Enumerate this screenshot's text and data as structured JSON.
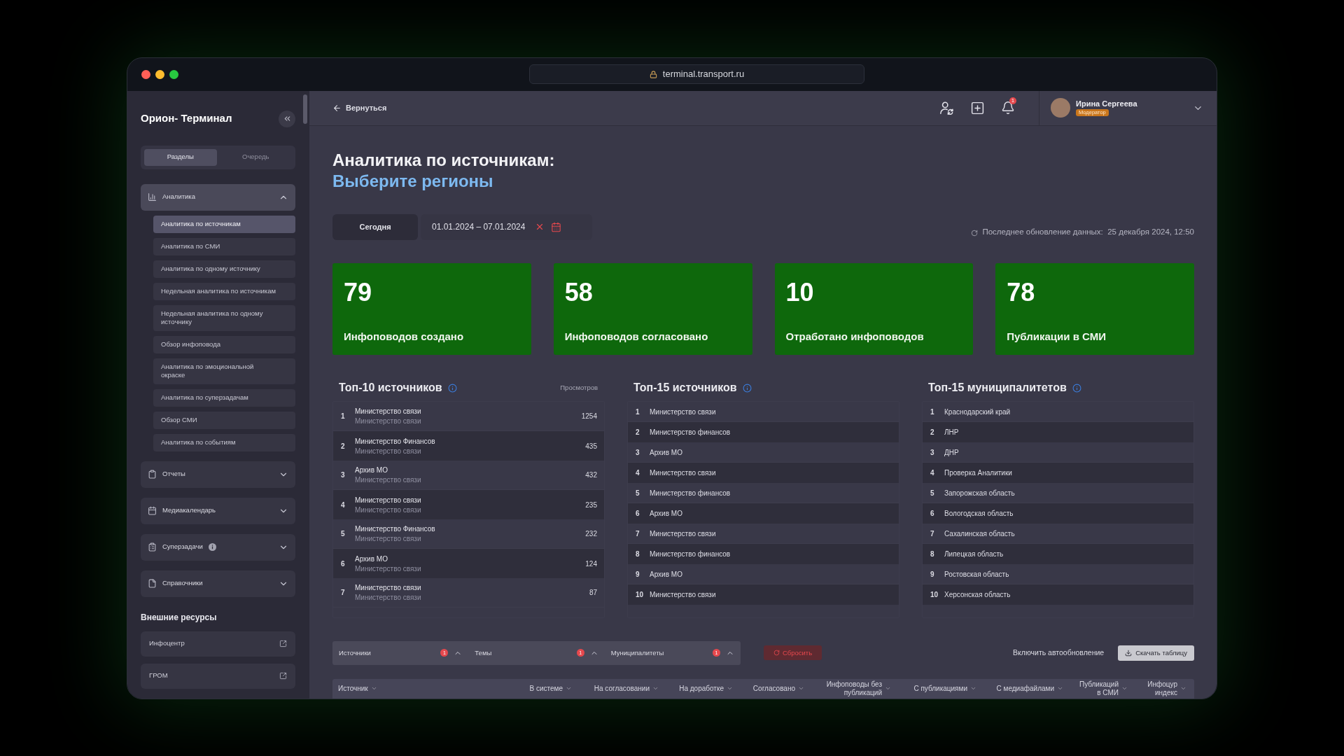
{
  "browser": {
    "url": "terminal.transport.ru"
  },
  "sidebar": {
    "title": "Орион- Терминал",
    "tabs": [
      {
        "label": "Разделы",
        "selected": true
      },
      {
        "label": "Очередь",
        "selected": false
      }
    ],
    "sections": [
      {
        "label": "Аналитика",
        "expanded": true,
        "info_badge": false,
        "children": [
          {
            "label": "Аналитика по источникам",
            "selected": true
          },
          {
            "label": "Аналитика по СМИ",
            "selected": false
          },
          {
            "label": "Аналитика по одному источнику",
            "selected": false
          },
          {
            "label": "Недельная аналитика по источникам",
            "selected": false
          },
          {
            "label": "Недельная аналитика по одному источнику",
            "selected": false
          },
          {
            "label": "Обзор инфоповода",
            "selected": false
          },
          {
            "label": "Аналитика по эмоциональной окраске",
            "selected": false
          },
          {
            "label": "Аналитика по суперзадачам",
            "selected": false
          },
          {
            "label": "Обзор СМИ",
            "selected": false
          },
          {
            "label": "Аналитика по событиям",
            "selected": false
          }
        ]
      },
      {
        "label": "Отчеты",
        "expanded": false,
        "info_badge": false
      },
      {
        "label": "Медиакалендарь",
        "expanded": false,
        "info_badge": false
      },
      {
        "label": "Суперзадачи",
        "expanded": false,
        "info_badge": true
      },
      {
        "label": "Справочники",
        "expanded": false,
        "info_badge": false
      }
    ],
    "external_title": "Внешние ресурсы",
    "external_links": [
      {
        "label": "Инфоцентр"
      },
      {
        "label": "ГРОМ"
      }
    ]
  },
  "header": {
    "back": "Вернуться",
    "notification_count": "1",
    "user": {
      "name": "Ирина Сергеева",
      "role": "Модератор"
    }
  },
  "page": {
    "title": "Аналитика по источникам:",
    "subtitle": "Выберите регионы",
    "today_button": "Сегодня",
    "date_range": "01.01.2024 – 07.01.2024",
    "last_update": "Последнее обновление данных:  25 декабря 2024, 12:50"
  },
  "stats": [
    {
      "value": "79",
      "label": "Инфоповодов создано"
    },
    {
      "value": "58",
      "label": "Инфоповодов согласовано"
    },
    {
      "value": "10",
      "label": "Отработано инфоповодов"
    },
    {
      "value": "78",
      "label": "Публикации в СМИ"
    }
  ],
  "top10_sources": {
    "title": "Топ-10 источников",
    "column": "Просмотров",
    "rows": [
      {
        "rank": "1",
        "name": "Министерство связи",
        "subtitle": "Министерство связи",
        "views": "1254"
      },
      {
        "rank": "2",
        "name": "Министерство Финансов",
        "subtitle": "Министерство связи",
        "views": "435"
      },
      {
        "rank": "3",
        "name": "Архив МО",
        "subtitle": "Министерство связи",
        "views": "432"
      },
      {
        "rank": "4",
        "name": "Министерство связи",
        "subtitle": "Министерство связи",
        "views": "235"
      },
      {
        "rank": "5",
        "name": "Министерство Финансов",
        "subtitle": "Министерство связи",
        "views": "232"
      },
      {
        "rank": "6",
        "name": "Архив МО",
        "subtitle": "Министерство связи",
        "views": "124"
      },
      {
        "rank": "7",
        "name": "Министерство связи",
        "subtitle": "Министерство связи",
        "views": "87"
      }
    ]
  },
  "top15_sources": {
    "title": "Топ-15 источников",
    "rows": [
      {
        "rank": "1",
        "name": "Министерство связи"
      },
      {
        "rank": "2",
        "name": "Министерство финансов"
      },
      {
        "rank": "3",
        "name": "Архив МО"
      },
      {
        "rank": "4",
        "name": "Министерство связи"
      },
      {
        "rank": "5",
        "name": "Министерство финансов"
      },
      {
        "rank": "6",
        "name": "Архив МО"
      },
      {
        "rank": "7",
        "name": "Министерство связи"
      },
      {
        "rank": "8",
        "name": "Министерство финансов"
      },
      {
        "rank": "9",
        "name": "Архив МО"
      },
      {
        "rank": "10",
        "name": "Министерство связи"
      }
    ]
  },
  "top15_municipalities": {
    "title": "Топ-15 муниципалитетов",
    "rows": [
      {
        "rank": "1",
        "name": "Краснодарский край"
      },
      {
        "rank": "2",
        "name": "ЛНР"
      },
      {
        "rank": "3",
        "name": "ДНР"
      },
      {
        "rank": "4",
        "name": "Проверка Аналитики"
      },
      {
        "rank": "5",
        "name": "Запорожская область"
      },
      {
        "rank": "6",
        "name": "Вологодская область"
      },
      {
        "rank": "7",
        "name": "Сахалинская область"
      },
      {
        "rank": "8",
        "name": "Липецкая область"
      },
      {
        "rank": "9",
        "name": "Ростовская область"
      },
      {
        "rank": "10",
        "name": "Херсонская область"
      }
    ]
  },
  "filters": {
    "groups": [
      {
        "label": "Источники",
        "count": "1"
      },
      {
        "label": "Темы",
        "count": "1"
      },
      {
        "label": "Муниципалитеты",
        "count": "1"
      }
    ],
    "reset": "Сбросить",
    "autoupdate": "Включить автообновление",
    "download": "Скачать таблицу"
  },
  "table": {
    "columns": [
      "Источник",
      "В системе",
      "На согласовании",
      "На доработке",
      "Согласовано",
      "Инфоповоды без публикаций",
      "С публикациями",
      "С медиафайлами",
      "Публикаций в СМИ",
      "Инфоцур индекс"
    ]
  }
}
